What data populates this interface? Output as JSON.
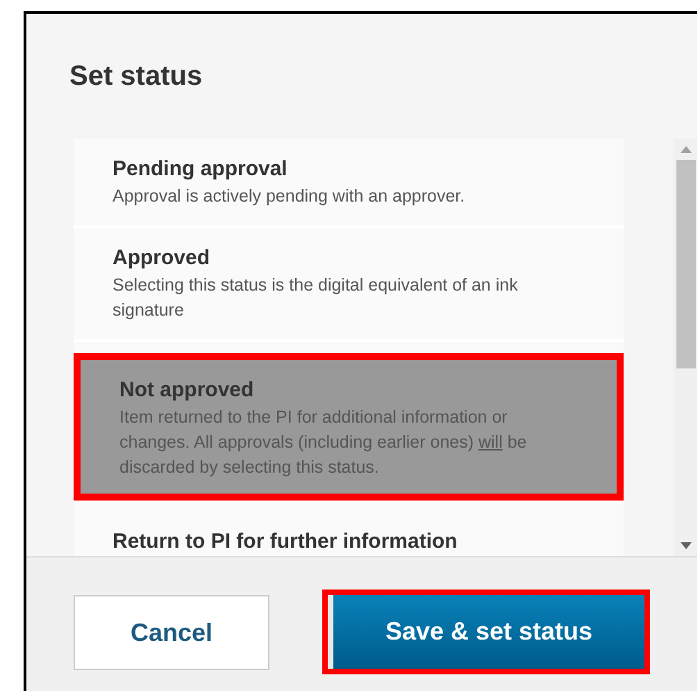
{
  "dialog": {
    "title": "Set status"
  },
  "statuses": [
    {
      "name": "Pending approval",
      "description": [
        {
          "text": "Approval is actively pending with an approver.",
          "underline": false
        }
      ],
      "selected": false,
      "highlighted": false
    },
    {
      "name": "Approved",
      "description": [
        {
          "text": "Selecting this status is the digital equivalent of an ink signature",
          "underline": false
        }
      ],
      "selected": false,
      "highlighted": false
    },
    {
      "name": "Not approved",
      "description": [
        {
          "text": "Item returned to the PI for additional information or changes. All approvals (including earlier ones) ",
          "underline": false
        },
        {
          "text": "will",
          "underline": true
        },
        {
          "text": " be discarded by selecting this status.",
          "underline": false
        }
      ],
      "selected": true,
      "highlighted": true
    },
    {
      "name": "Return to PI for further information",
      "selected": false,
      "highlighted": false
    }
  ],
  "buttons": [
    {
      "label": "Cancel",
      "kind": "secondary",
      "highlighted": false
    },
    {
      "label": "Save & set status",
      "kind": "primary",
      "highlighted": true
    }
  ]
}
